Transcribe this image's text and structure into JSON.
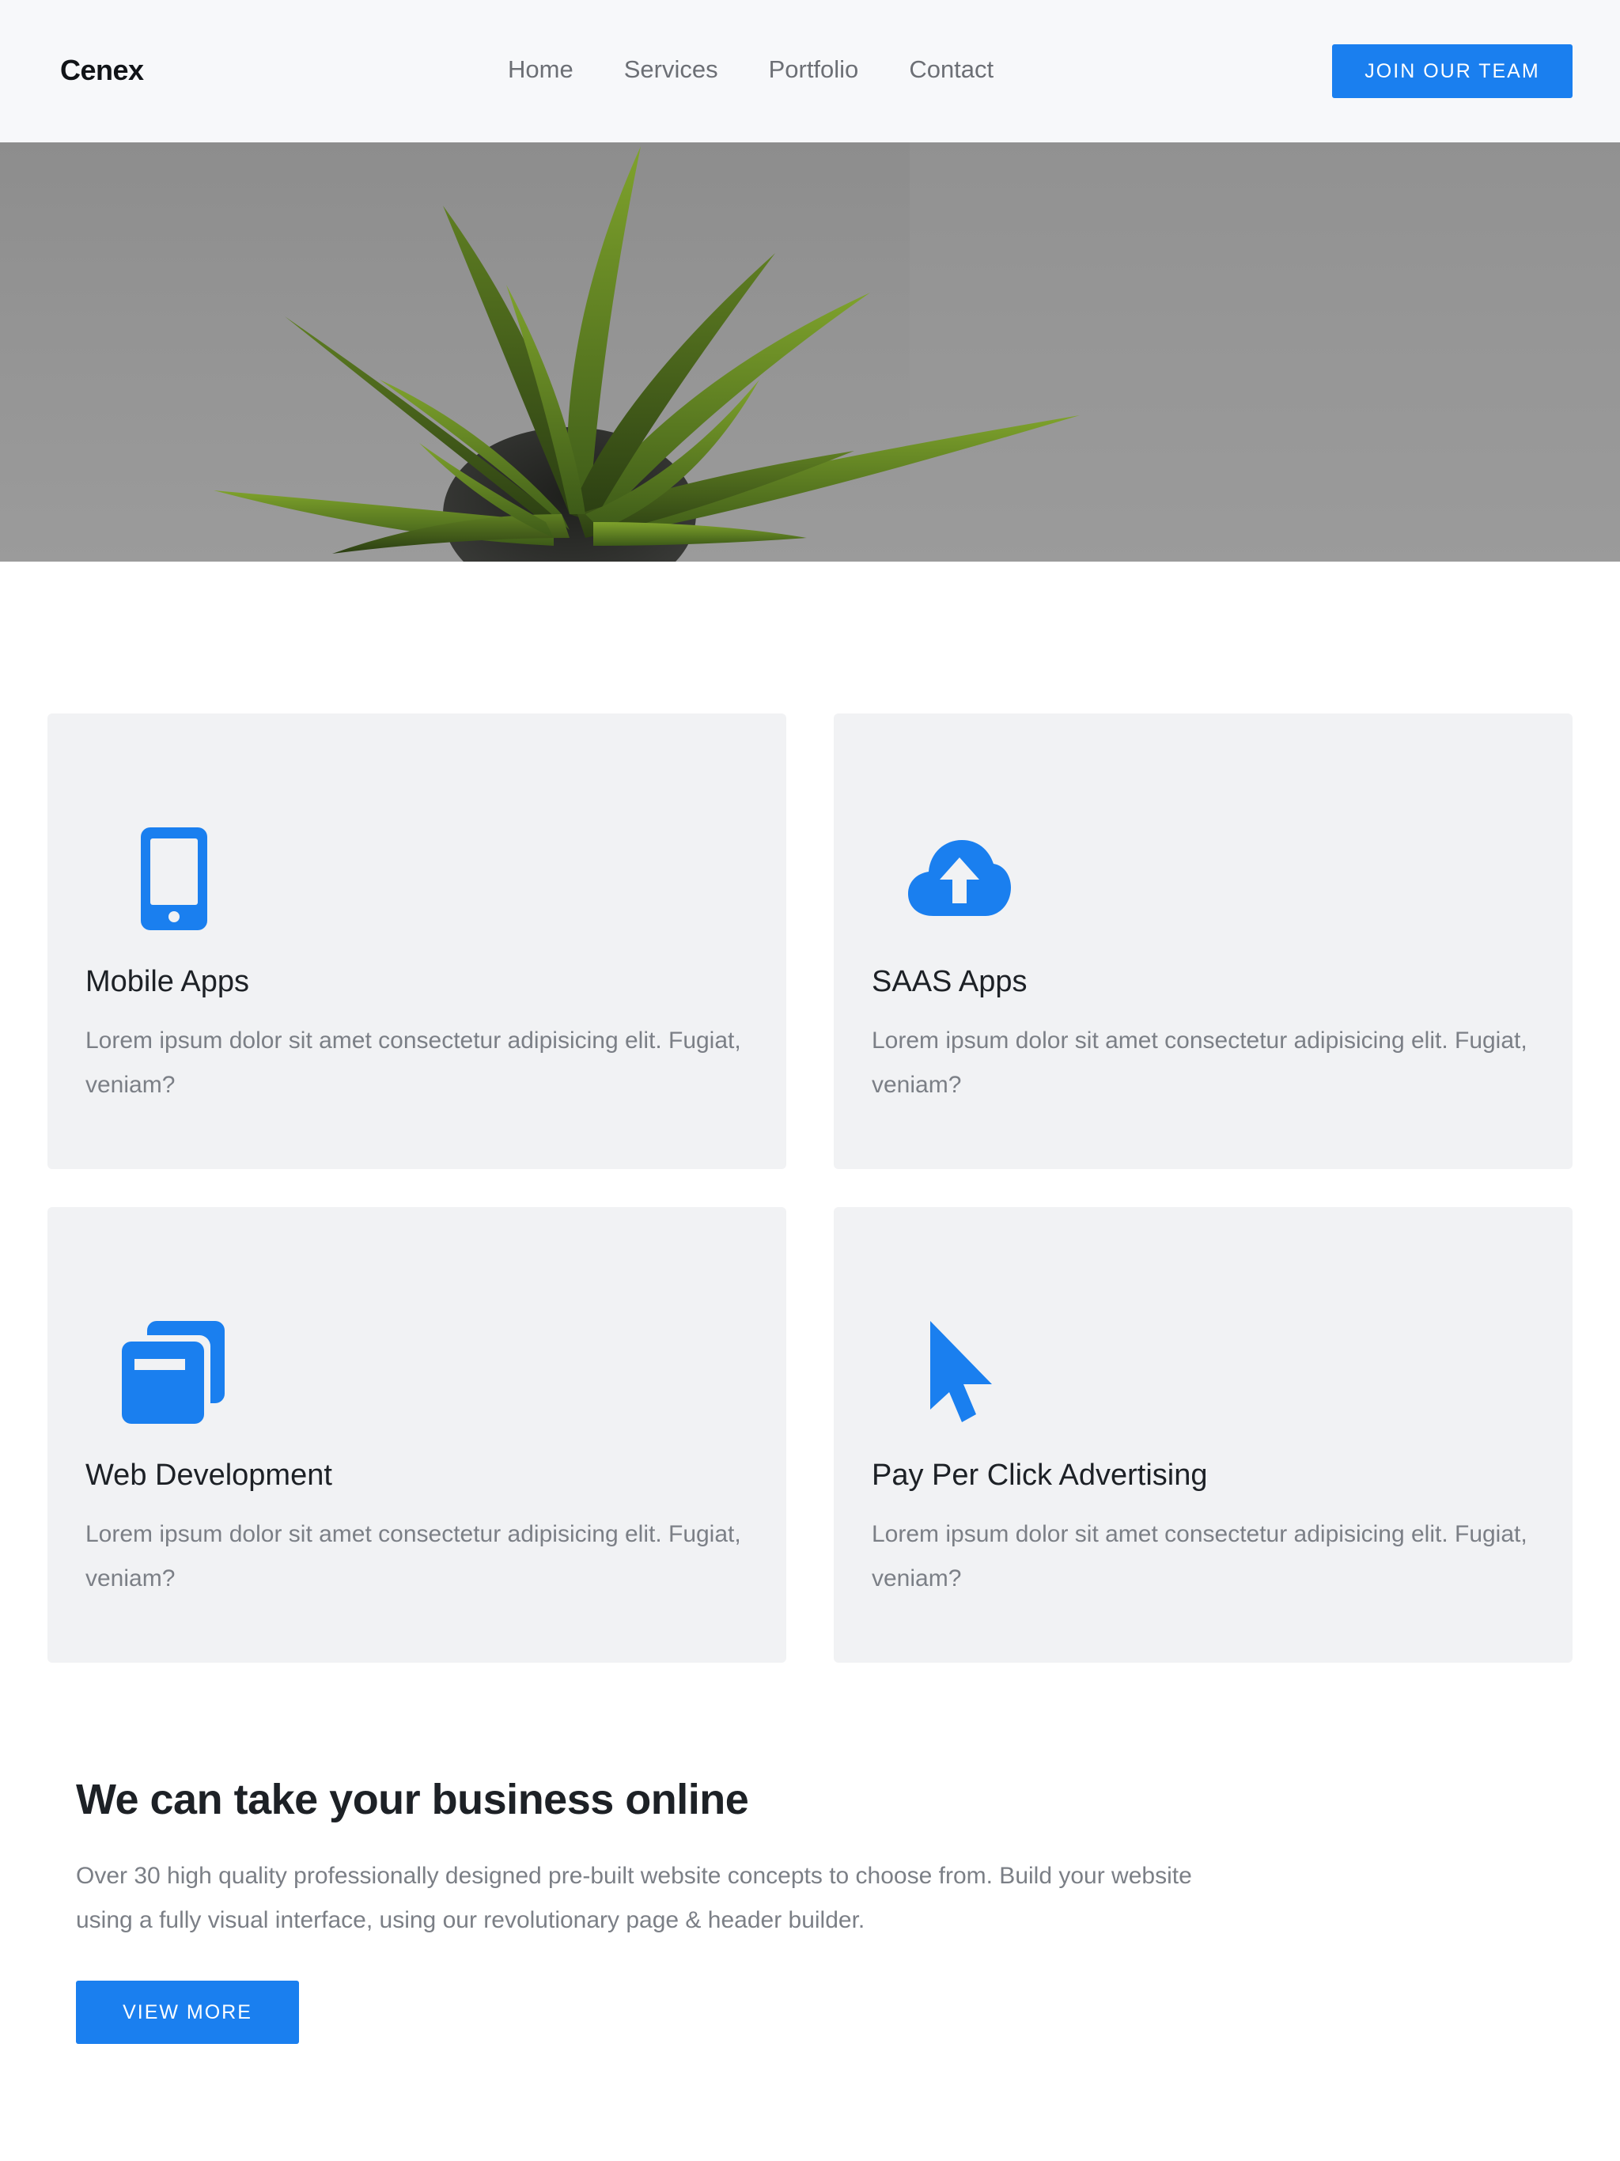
{
  "navbar": {
    "brand": "Cenex",
    "links": [
      "Home",
      "Services",
      "Portfolio",
      "Contact"
    ],
    "cta_label": "JOIN OUR TEAM"
  },
  "services": [
    {
      "icon": "mobile-phone-icon",
      "title": "Mobile Apps",
      "text": "Lorem ipsum dolor sit amet consectetur adipisicing elit. Fugiat, veniam?"
    },
    {
      "icon": "cloud-upload-icon",
      "title": "SAAS Apps",
      "text": "Lorem ipsum dolor sit amet consectetur adipisicing elit. Fugiat, veniam?"
    },
    {
      "icon": "windows-stack-icon",
      "title": "Web Development",
      "text": "Lorem ipsum dolor sit amet consectetur adipisicing elit. Fugiat, veniam?"
    },
    {
      "icon": "mouse-pointer-icon",
      "title": "Pay Per Click Advertising",
      "text": "Lorem ipsum dolor sit amet consectetur adipisicing elit. Fugiat, veniam?"
    }
  ],
  "cta": {
    "title": "We can take your business online",
    "text": "Over 30 high quality professionally designed pre-built website concepts to choose from. Build your website using a fully visual interface, using our revolutionary page & header builder.",
    "button_label": "VIEW MORE"
  },
  "colors": {
    "accent": "#1a7fef",
    "card_bg": "#f1f2f4",
    "navbar_bg": "#f7f8fa"
  }
}
